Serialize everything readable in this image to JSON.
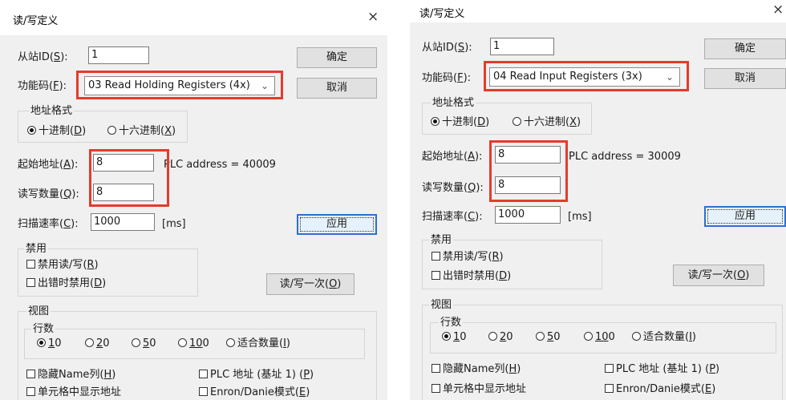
{
  "left": {
    "title": "读/写定义",
    "close": "×",
    "slave_label": "从站ID(",
    "slave_key": "S",
    "slave_tail": "):",
    "slave_value": "1",
    "ok": "确定",
    "func_label": "功能码(",
    "func_key": "F",
    "func_tail": "):",
    "func_value": "03 Read Holding Registers (4x)",
    "cancel": "取消",
    "addr_format": "地址格式",
    "dec_label": "十进制(",
    "dec_key": "D",
    "dec_tail": ")",
    "hex_label": "十六进制(",
    "hex_key": "X",
    "hex_tail": ")",
    "start_label": "起始地址(",
    "start_key": "A",
    "start_tail": "):",
    "start_value": "8",
    "plc_address": "PLC address = 40009",
    "qty_label": "读写数量(",
    "qty_key": "Q",
    "qty_tail": "):",
    "qty_value": "8",
    "scan_label": "扫描速率(",
    "scan_key": "C",
    "scan_tail": "):",
    "scan_value": "1000",
    "ms": "[ms]",
    "apply": "应用",
    "disable": "禁用",
    "disable_rw_label": "禁用读/写(",
    "disable_rw_key": "R",
    "disable_rw_tail": ")",
    "disable_err_label": "出错时禁用(",
    "disable_err_key": "D",
    "disable_err_tail": ")",
    "rw_once_label": "读/写一次(",
    "rw_once_key": "O",
    "rw_once_tail": ")",
    "view": "视图",
    "rows": "行数",
    "r10a": "1",
    "r10b": "0",
    "r20a": "2",
    "r20b": "0",
    "r50a": "5",
    "r50b": "0",
    "r100a": "10",
    "r100b": "0",
    "fit_label": "适合数量(",
    "fit_key": "I",
    "fit_tail": ")",
    "hide_name_label": "隐藏Name列(",
    "hide_name_key": "H",
    "hide_name_tail": ")",
    "plc_addr_base_label": "PLC 地址 (基址 1) (",
    "plc_addr_base_key": "P",
    "plc_addr_base_tail": ")",
    "show_addr": "单元格中显示地址",
    "enron_label": "Enron/Danie模式(",
    "enron_key": "E",
    "enron_tail": ")"
  },
  "right": {
    "title": "读/写定义",
    "close": "×",
    "slave_label": "从站ID(",
    "slave_key": "S",
    "slave_tail": "):",
    "slave_value": "1",
    "ok": "确定",
    "func_label": "功能码(",
    "func_key": "F",
    "func_tail": "):",
    "func_value": "04 Read Input Registers (3x)",
    "cancel": "取消",
    "addr_format": "地址格式",
    "dec_label": "十进制(",
    "dec_key": "D",
    "dec_tail": ")",
    "hex_label": "十六进制(",
    "hex_key": "X",
    "hex_tail": ")",
    "start_label": "起始地址(",
    "start_key": "A",
    "start_tail": "):",
    "start_value": "8",
    "plc_address": "PLC address = 30009",
    "qty_label": "读写数量(",
    "qty_key": "Q",
    "qty_tail": "):",
    "qty_value": "8",
    "scan_label": "扫描速率(",
    "scan_key": "C",
    "scan_tail": "):",
    "scan_value": "1000",
    "ms": "[ms]",
    "apply": "应用",
    "disable": "禁用",
    "disable_rw_label": "禁用读/写(",
    "disable_rw_key": "R",
    "disable_rw_tail": ")",
    "disable_err_label": "出错时禁用(",
    "disable_err_key": "D",
    "disable_err_tail": ")",
    "rw_once_label": "读/写一次(",
    "rw_once_key": "O",
    "rw_once_tail": ")",
    "view": "视图",
    "rows": "行数",
    "r10a": "1",
    "r10b": "0",
    "r20a": "2",
    "r20b": "0",
    "r50a": "5",
    "r50b": "0",
    "r100a": "10",
    "r100b": "0",
    "fit_label": "适合数量(",
    "fit_key": "I",
    "fit_tail": ")",
    "hide_name_label": "隐藏Name列(",
    "hide_name_key": "H",
    "hide_name_tail": ")",
    "plc_addr_base_label": "PLC 地址 (基址 1) (",
    "plc_addr_base_key": "P",
    "plc_addr_base_tail": ")",
    "show_addr": "单元格中显示地址",
    "enron_label": "Enron/Danie模式(",
    "enron_key": "E",
    "enron_tail": ")"
  },
  "colors": {
    "highlight_box": "#e53b2c",
    "default_button_border": "#2f6fd0",
    "dialog_bg": "#f0f0f0"
  },
  "icons": {
    "close": "close-icon",
    "dropdown": "chevron-down-icon"
  }
}
